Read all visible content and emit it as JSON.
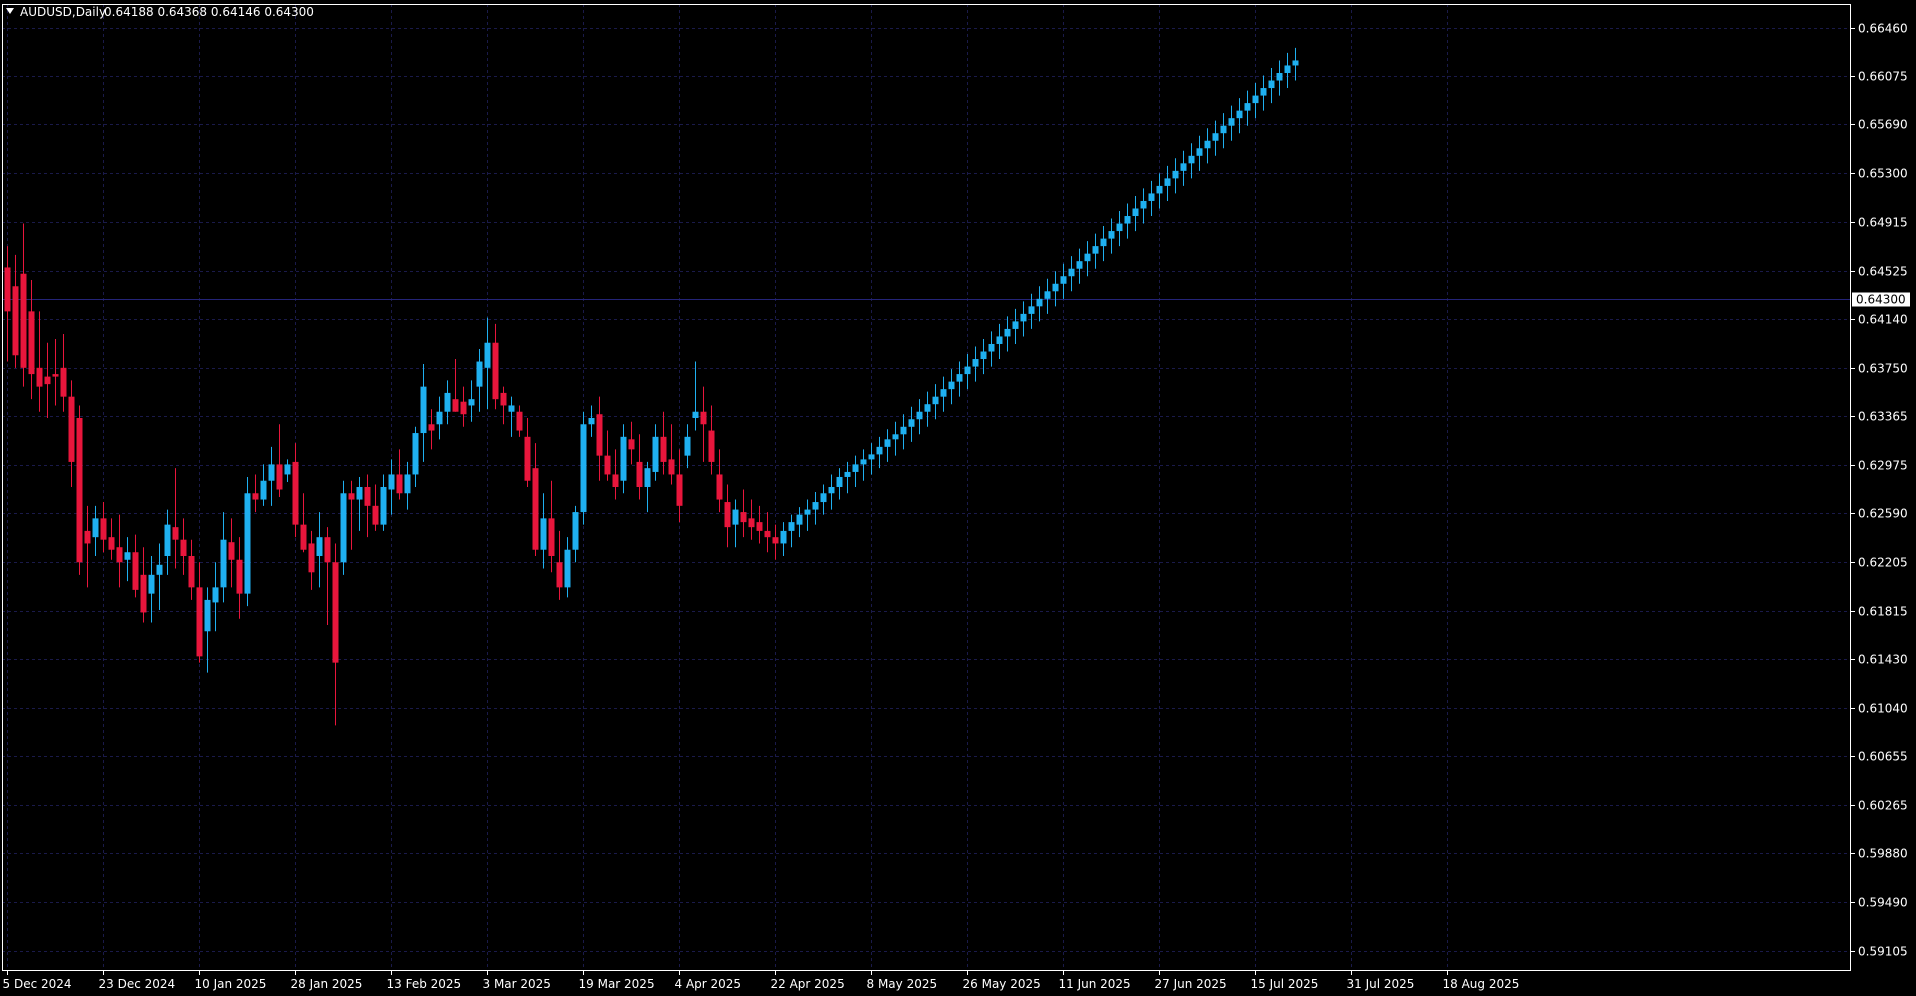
{
  "header": {
    "symbol": "AUDUSD,Daily",
    "ohlc": "0.64188 0.64368 0.64146 0.64300"
  },
  "current_price_label": "0.64300",
  "colors": {
    "background": "#000000",
    "grid": "#1a1a4a",
    "axis": "#ffffff",
    "bull": "#1fb0f0",
    "bear": "#e8163c",
    "price_line": "#242478",
    "label_bg": "#ffffff",
    "label_text": "#000000"
  },
  "chart_data": {
    "type": "candlestick",
    "symbol": "AUDUSD",
    "timeframe": "Daily",
    "ylim": [
      0.5895,
      0.6665
    ],
    "current_price": 0.643,
    "y_ticks": [
      "0.66460",
      "0.66075",
      "0.65690",
      "0.65300",
      "0.64915",
      "0.64525",
      "0.64140",
      "0.63750",
      "0.63365",
      "0.62975",
      "0.62590",
      "0.62205",
      "0.61815",
      "0.61430",
      "0.61040",
      "0.60655",
      "0.60265",
      "0.59880",
      "0.59490",
      "0.59105"
    ],
    "x_labels": [
      {
        "bar": 0,
        "label": "5 Dec 2024"
      },
      {
        "bar": 12,
        "label": "23 Dec 2024"
      },
      {
        "bar": 24,
        "label": "10 Jan 2025"
      },
      {
        "bar": 36,
        "label": "28 Jan 2025"
      },
      {
        "bar": 48,
        "label": "13 Feb 2025"
      },
      {
        "bar": 60,
        "label": "3 Mar 2025"
      },
      {
        "bar": 72,
        "label": "19 Mar 2025"
      },
      {
        "bar": 84,
        "label": "4 Apr 2025"
      },
      {
        "bar": 96,
        "label": "22 Apr 2025"
      },
      {
        "bar": 108,
        "label": "8 May 2025"
      },
      {
        "bar": 120,
        "label": "26 May 2025"
      },
      {
        "bar": 132,
        "label": "11 Jun 2025"
      },
      {
        "bar": 144,
        "label": "27 Jun 2025"
      },
      {
        "bar": 156,
        "label": "15 Jul 2025"
      },
      {
        "bar": 168,
        "label": "31 Jul 2025"
      },
      {
        "bar": 180,
        "label": "18 Aug 2025"
      }
    ],
    "candles": [
      [
        0.6455,
        0.6472,
        0.638,
        0.642
      ],
      [
        0.644,
        0.6465,
        0.6375,
        0.6385
      ],
      [
        0.645,
        0.649,
        0.636,
        0.6375
      ],
      [
        0.642,
        0.6445,
        0.635,
        0.637
      ],
      [
        0.6375,
        0.642,
        0.634,
        0.636
      ],
      [
        0.6368,
        0.6395,
        0.6335,
        0.6362
      ],
      [
        0.637,
        0.6398,
        0.6345,
        0.6368
      ],
      [
        0.6375,
        0.6402,
        0.634,
        0.6352
      ],
      [
        0.6352,
        0.6365,
        0.628,
        0.63
      ],
      [
        0.6335,
        0.6345,
        0.621,
        0.622
      ],
      [
        0.6245,
        0.6265,
        0.62,
        0.6235
      ],
      [
        0.624,
        0.6265,
        0.6225,
        0.6255
      ],
      [
        0.6255,
        0.6268,
        0.6228,
        0.6238
      ],
      [
        0.624,
        0.6255,
        0.6222,
        0.623
      ],
      [
        0.6232,
        0.6258,
        0.62,
        0.622
      ],
      [
        0.6222,
        0.624,
        0.6205,
        0.6228
      ],
      [
        0.6228,
        0.6242,
        0.6192,
        0.6198
      ],
      [
        0.621,
        0.6232,
        0.6172,
        0.618
      ],
      [
        0.6195,
        0.6225,
        0.6172,
        0.621
      ],
      [
        0.621,
        0.6235,
        0.6182,
        0.6218
      ],
      [
        0.6225,
        0.6262,
        0.621,
        0.625
      ],
      [
        0.6248,
        0.6295,
        0.6215,
        0.6238
      ],
      [
        0.6238,
        0.6255,
        0.621,
        0.6225
      ],
      [
        0.6225,
        0.6238,
        0.619,
        0.62
      ],
      [
        0.62,
        0.622,
        0.614,
        0.6145
      ],
      [
        0.6165,
        0.62,
        0.6132,
        0.619
      ],
      [
        0.6188,
        0.622,
        0.6165,
        0.62
      ],
      [
        0.62,
        0.626,
        0.6188,
        0.6238
      ],
      [
        0.6236,
        0.6255,
        0.62,
        0.6222
      ],
      [
        0.6222,
        0.624,
        0.6175,
        0.6195
      ],
      [
        0.6195,
        0.6288,
        0.6185,
        0.6275
      ],
      [
        0.6275,
        0.629,
        0.626,
        0.627
      ],
      [
        0.627,
        0.6298,
        0.6265,
        0.6285
      ],
      [
        0.6285,
        0.6312,
        0.6265,
        0.6298
      ],
      [
        0.6298,
        0.633,
        0.6272,
        0.6278
      ],
      [
        0.629,
        0.6302,
        0.6284,
        0.6298
      ],
      [
        0.63,
        0.6315,
        0.624,
        0.625
      ],
      [
        0.625,
        0.6275,
        0.6228,
        0.623
      ],
      [
        0.6235,
        0.6245,
        0.6198,
        0.6212
      ],
      [
        0.6225,
        0.626,
        0.62,
        0.624
      ],
      [
        0.624,
        0.6248,
        0.617,
        0.622
      ],
      [
        0.622,
        0.6235,
        0.609,
        0.614
      ],
      [
        0.622,
        0.6285,
        0.621,
        0.6275
      ],
      [
        0.6275,
        0.6285,
        0.623,
        0.627
      ],
      [
        0.627,
        0.6288,
        0.6245,
        0.628
      ],
      [
        0.628,
        0.629,
        0.624,
        0.6265
      ],
      [
        0.6265,
        0.6282,
        0.6245,
        0.625
      ],
      [
        0.625,
        0.629,
        0.6245,
        0.628
      ],
      [
        0.6278,
        0.6302,
        0.6258,
        0.629
      ],
      [
        0.629,
        0.631,
        0.627,
        0.6275
      ],
      [
        0.6275,
        0.63,
        0.6262,
        0.629
      ],
      [
        0.629,
        0.6328,
        0.628,
        0.6323
      ],
      [
        0.6323,
        0.6378,
        0.63,
        0.636
      ],
      [
        0.633,
        0.6342,
        0.631,
        0.6325
      ],
      [
        0.633,
        0.6352,
        0.6318,
        0.634
      ],
      [
        0.634,
        0.6365,
        0.633,
        0.6355
      ],
      [
        0.635,
        0.6382,
        0.634,
        0.634
      ],
      [
        0.6348,
        0.636,
        0.6328,
        0.6338
      ],
      [
        0.6345,
        0.6365,
        0.6332,
        0.635
      ],
      [
        0.636,
        0.639,
        0.634,
        0.638
      ],
      [
        0.6375,
        0.6415,
        0.6342,
        0.6395
      ],
      [
        0.6395,
        0.641,
        0.6342,
        0.635
      ],
      [
        0.6355,
        0.636,
        0.633,
        0.6345
      ],
      [
        0.634,
        0.6352,
        0.632,
        0.6345
      ],
      [
        0.634,
        0.6345,
        0.632,
        0.6325
      ],
      [
        0.632,
        0.6335,
        0.628,
        0.6285
      ],
      [
        0.6295,
        0.6315,
        0.6225,
        0.623
      ],
      [
        0.623,
        0.6275,
        0.6215,
        0.6255
      ],
      [
        0.6255,
        0.6285,
        0.6212,
        0.6225
      ],
      [
        0.622,
        0.6245,
        0.619,
        0.62
      ],
      [
        0.62,
        0.624,
        0.6192,
        0.623
      ],
      [
        0.623,
        0.6265,
        0.622,
        0.626
      ],
      [
        0.626,
        0.634,
        0.625,
        0.633
      ],
      [
        0.633,
        0.6345,
        0.632,
        0.6335
      ],
      [
        0.6338,
        0.6352,
        0.6285,
        0.6305
      ],
      [
        0.6305,
        0.6325,
        0.6285,
        0.629
      ],
      [
        0.629,
        0.631,
        0.627,
        0.628
      ],
      [
        0.6285,
        0.633,
        0.6275,
        0.632
      ],
      [
        0.6318,
        0.6332,
        0.6298,
        0.631
      ],
      [
        0.63,
        0.6322,
        0.627,
        0.628
      ],
      [
        0.628,
        0.63,
        0.626,
        0.6295
      ],
      [
        0.6292,
        0.633,
        0.6285,
        0.632
      ],
      [
        0.632,
        0.634,
        0.629,
        0.63
      ],
      [
        0.6302,
        0.633,
        0.6282,
        0.629
      ],
      [
        0.629,
        0.631,
        0.6252,
        0.6265
      ],
      [
        0.6305,
        0.633,
        0.6295,
        0.632
      ],
      [
        0.6335,
        0.638,
        0.6325,
        0.634
      ],
      [
        0.634,
        0.636,
        0.63,
        0.633
      ],
      [
        0.6325,
        0.6345,
        0.629,
        0.63
      ],
      [
        0.629,
        0.631,
        0.626,
        0.627
      ],
      [
        0.6268,
        0.6282,
        0.6232,
        0.6248
      ],
      [
        0.625,
        0.627,
        0.6232,
        0.6262
      ],
      [
        0.626,
        0.6278,
        0.624,
        0.6252
      ],
      [
        0.6255,
        0.627,
        0.6238,
        0.6248
      ],
      [
        0.6252,
        0.6265,
        0.6235,
        0.6245
      ],
      [
        0.6245,
        0.626,
        0.6228,
        0.624
      ],
      [
        0.624,
        0.625,
        0.6222,
        0.6235
      ],
      [
        0.6235,
        0.6252,
        0.6225,
        0.6245
      ],
      [
        0.6245,
        0.6258,
        0.6232,
        0.6252
      ],
      [
        0.625,
        0.6264,
        0.624,
        0.6258
      ],
      [
        0.6258,
        0.627,
        0.6245,
        0.6262
      ],
      [
        0.6262,
        0.6276,
        0.625,
        0.6268
      ],
      [
        0.6268,
        0.6282,
        0.6258,
        0.6275
      ],
      [
        0.6275,
        0.629,
        0.6262,
        0.628
      ],
      [
        0.628,
        0.6295,
        0.627,
        0.6288
      ],
      [
        0.6288,
        0.63,
        0.6275,
        0.6292
      ],
      [
        0.6292,
        0.6305,
        0.628,
        0.6298
      ],
      [
        0.6298,
        0.631,
        0.6285,
        0.6302
      ],
      [
        0.6302,
        0.6315,
        0.629,
        0.6306
      ],
      [
        0.6306,
        0.632,
        0.6295,
        0.6312
      ],
      [
        0.6312,
        0.6326,
        0.63,
        0.6318
      ],
      [
        0.6318,
        0.6332,
        0.6305,
        0.6322
      ],
      [
        0.6322,
        0.6338,
        0.631,
        0.6328
      ],
      [
        0.6328,
        0.6344,
        0.6316,
        0.6334
      ],
      [
        0.6334,
        0.635,
        0.6322,
        0.634
      ],
      [
        0.634,
        0.6356,
        0.6328,
        0.6346
      ],
      [
        0.6346,
        0.6362,
        0.6334,
        0.6352
      ],
      [
        0.6352,
        0.6368,
        0.634,
        0.6358
      ],
      [
        0.6358,
        0.6374,
        0.6346,
        0.6364
      ],
      [
        0.6364,
        0.638,
        0.6352,
        0.637
      ],
      [
        0.637,
        0.6386,
        0.6358,
        0.6376
      ],
      [
        0.6376,
        0.6392,
        0.6364,
        0.6382
      ],
      [
        0.6382,
        0.6398,
        0.637,
        0.6388
      ],
      [
        0.6388,
        0.6404,
        0.6376,
        0.6394
      ],
      [
        0.6394,
        0.641,
        0.6382,
        0.64
      ],
      [
        0.64,
        0.6416,
        0.6388,
        0.6406
      ],
      [
        0.6406,
        0.6422,
        0.6394,
        0.6412
      ],
      [
        0.6412,
        0.6428,
        0.64,
        0.6418
      ],
      [
        0.6418,
        0.6434,
        0.6406,
        0.6424
      ],
      [
        0.6424,
        0.644,
        0.6412,
        0.643
      ],
      [
        0.643,
        0.6446,
        0.6418,
        0.6436
      ],
      [
        0.6436,
        0.6452,
        0.6424,
        0.6442
      ],
      [
        0.6442,
        0.6458,
        0.643,
        0.6448
      ],
      [
        0.6448,
        0.6464,
        0.6436,
        0.6454
      ],
      [
        0.6454,
        0.647,
        0.6442,
        0.646
      ],
      [
        0.646,
        0.6476,
        0.6448,
        0.6466
      ],
      [
        0.6466,
        0.6482,
        0.6454,
        0.6472
      ],
      [
        0.6472,
        0.6488,
        0.646,
        0.6478
      ],
      [
        0.6478,
        0.6494,
        0.6466,
        0.6484
      ],
      [
        0.6484,
        0.65,
        0.6472,
        0.649
      ],
      [
        0.649,
        0.6506,
        0.6478,
        0.6496
      ],
      [
        0.6496,
        0.6512,
        0.6484,
        0.6502
      ],
      [
        0.6502,
        0.6518,
        0.649,
        0.6508
      ],
      [
        0.6508,
        0.6524,
        0.6496,
        0.6514
      ],
      [
        0.6514,
        0.653,
        0.6502,
        0.652
      ],
      [
        0.652,
        0.6536,
        0.6508,
        0.6526
      ],
      [
        0.6526,
        0.6542,
        0.6514,
        0.6532
      ],
      [
        0.6532,
        0.6548,
        0.652,
        0.6538
      ],
      [
        0.6538,
        0.6554,
        0.6526,
        0.6544
      ],
      [
        0.6544,
        0.656,
        0.6532,
        0.655
      ],
      [
        0.655,
        0.6566,
        0.6538,
        0.6556
      ],
      [
        0.6556,
        0.6572,
        0.6544,
        0.6562
      ],
      [
        0.6562,
        0.6578,
        0.655,
        0.6568
      ],
      [
        0.6568,
        0.6584,
        0.6556,
        0.6574
      ],
      [
        0.6574,
        0.659,
        0.6562,
        0.658
      ],
      [
        0.658,
        0.6596,
        0.6568,
        0.6586
      ],
      [
        0.6586,
        0.6602,
        0.6574,
        0.6592
      ],
      [
        0.6592,
        0.6608,
        0.658,
        0.6598
      ],
      [
        0.6598,
        0.6614,
        0.6586,
        0.6604
      ],
      [
        0.6604,
        0.662,
        0.6592,
        0.661
      ],
      [
        0.661,
        0.6626,
        0.6598,
        0.6616
      ],
      [
        0.6616,
        0.663,
        0.6604,
        0.662
      ]
    ],
    "signals": []
  }
}
